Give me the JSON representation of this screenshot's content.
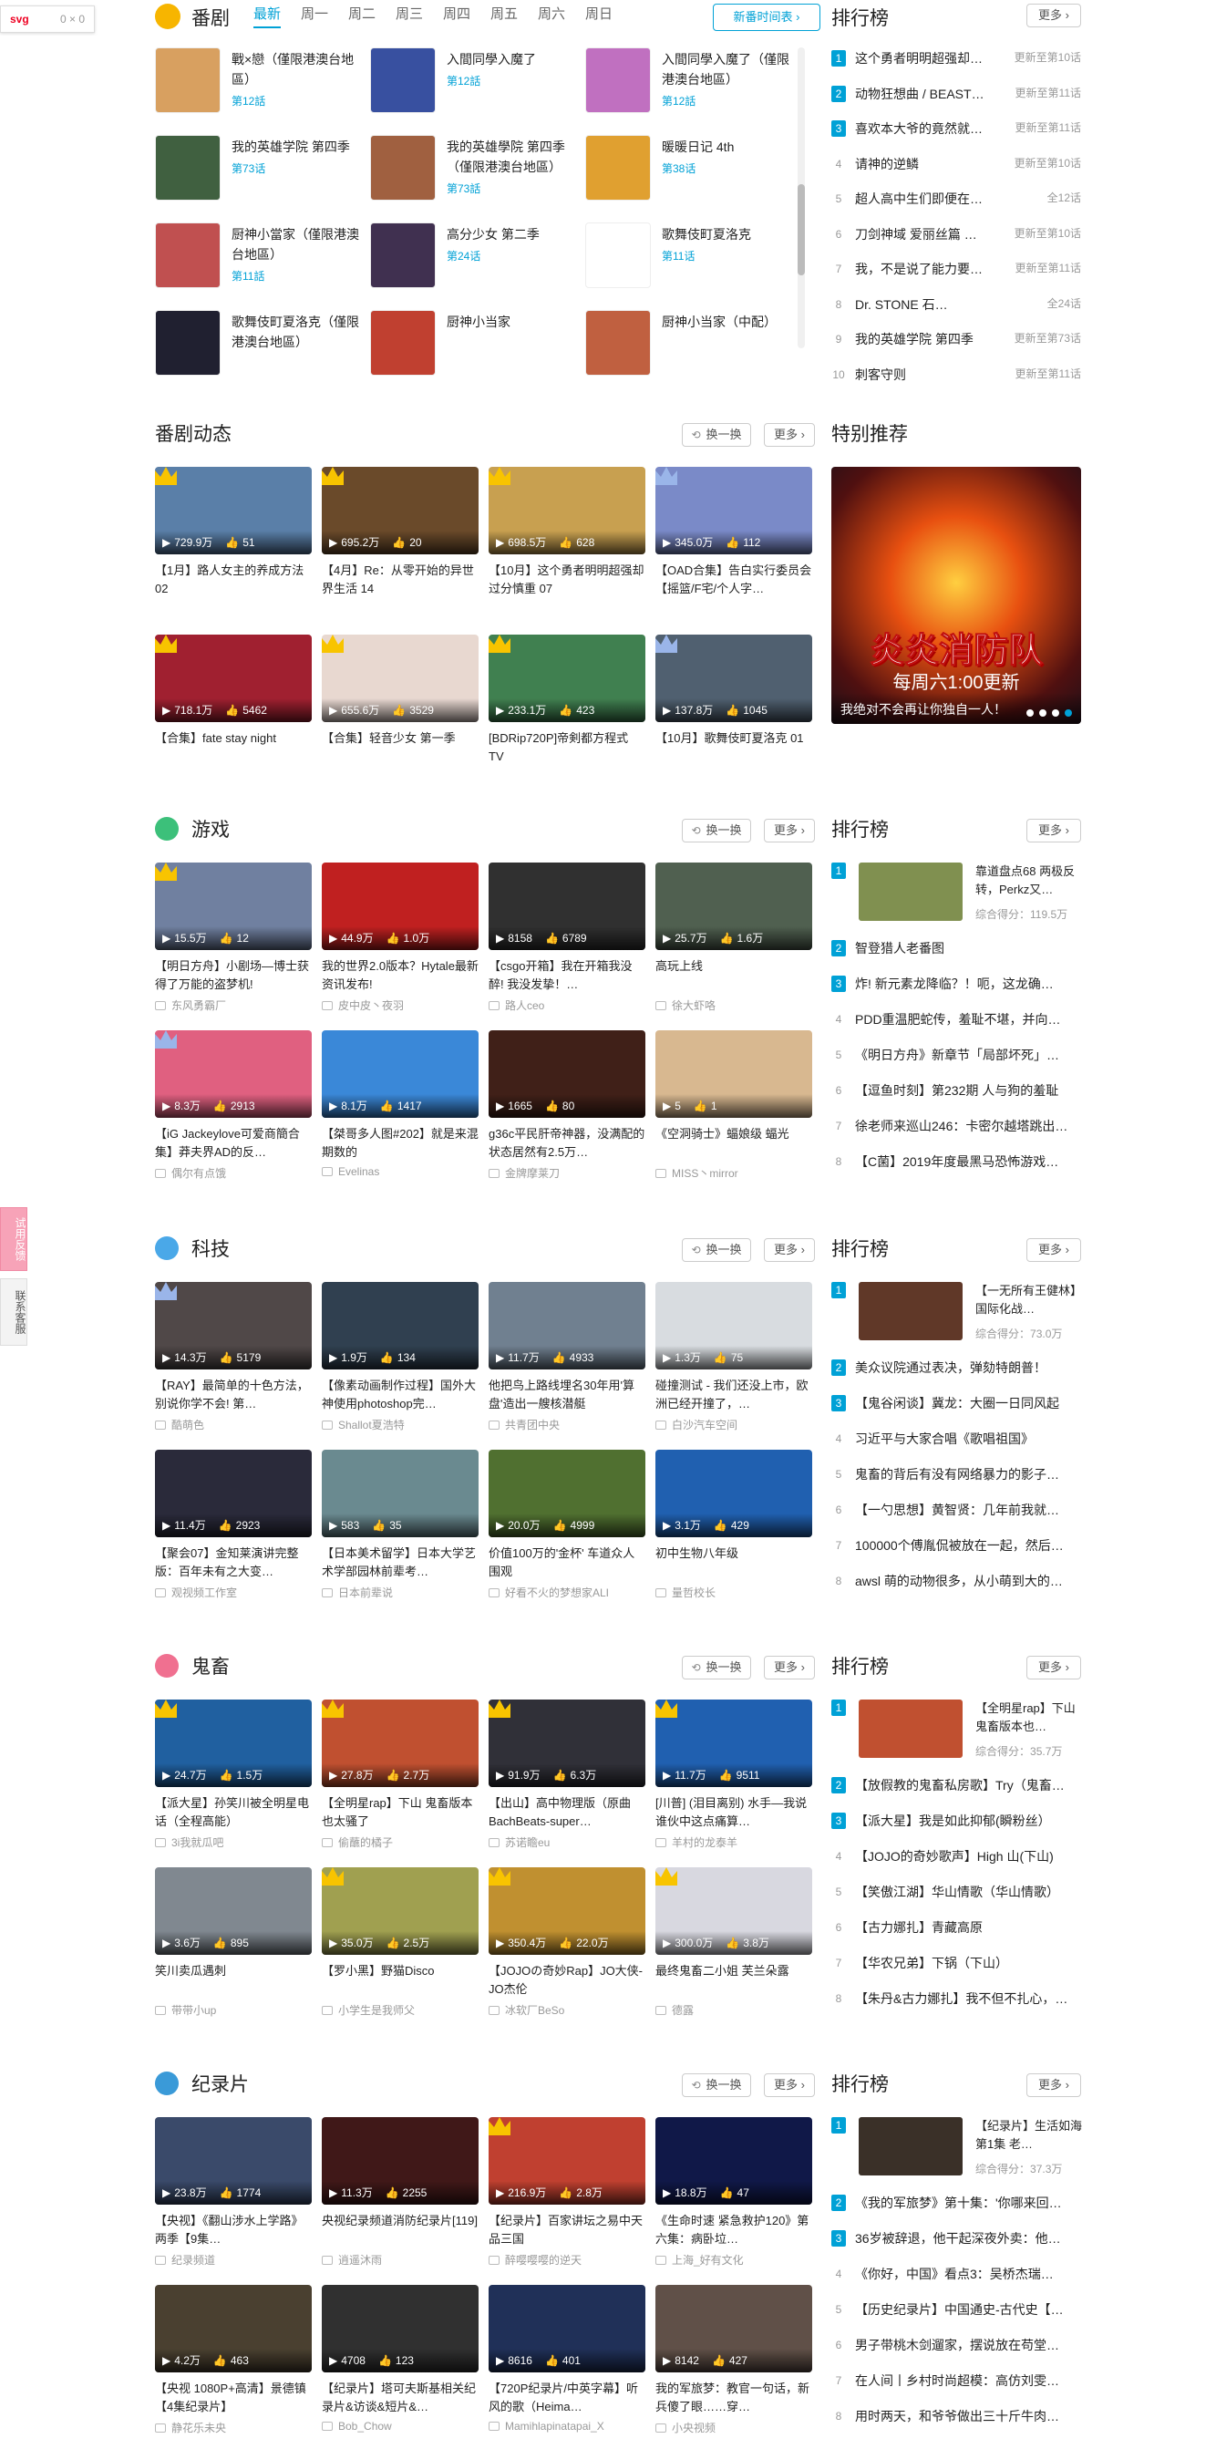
{
  "devbadge": {
    "label": "svg",
    "size": "0 × 0"
  },
  "feedback": {
    "label1": "试用反馈",
    "label2": "联系客服"
  },
  "common": {
    "more": "更多",
    "refresh": "换一换",
    "rank": "排行榜",
    "score_prefix": "综合得分："
  },
  "bangumi": {
    "title": "番剧",
    "tabs": [
      "最新",
      "周一",
      "周二",
      "周三",
      "周四",
      "周五",
      "周六",
      "周日"
    ],
    "new_timeline_btn": "新番时间表",
    "items": [
      {
        "title": "戰×戀（僅限港澳台地區）",
        "ep": "第12話",
        "color": "#d8a060"
      },
      {
        "title": "入間同學入魔了",
        "ep": "第12話",
        "color": "#3850a0"
      },
      {
        "title": "入間同學入魔了（僅限港澳台地區）",
        "ep": "第12話",
        "color": "#c070c0"
      },
      {
        "title": "我的英雄学院 第四季",
        "ep": "第73话",
        "color": "#406040"
      },
      {
        "title": "我的英雄學院 第四季（僅限港澳台地區）",
        "ep": "第73話",
        "color": "#a06040"
      },
      {
        "title": "暖暖日记 4th",
        "ep": "第38话",
        "color": "#e0a030"
      },
      {
        "title": "厨神小當家（僅限港澳台地區）",
        "ep": "第11話",
        "color": "#c05050"
      },
      {
        "title": "高分少女 第二季",
        "ep": "第24话",
        "color": "#403050"
      },
      {
        "title": "歌舞伎町夏洛克",
        "ep": "第11话",
        "color": "#ffffff"
      },
      {
        "title": "歌舞伎町夏洛克（僅限港澳台地區）",
        "ep": "",
        "color": "#202030"
      },
      {
        "title": "厨神小当家",
        "ep": "",
        "color": "#c04030"
      },
      {
        "title": "厨神小当家（中配）",
        "ep": "",
        "color": "#c06040"
      }
    ],
    "rank": [
      {
        "n": "1",
        "title": "这个勇者明明超强却…",
        "ep": "更新至第10话"
      },
      {
        "n": "2",
        "title": "动物狂想曲 / BEAST…",
        "ep": "更新至第11话"
      },
      {
        "n": "3",
        "title": "喜欢本大爷的竟然就…",
        "ep": "更新至第11话"
      },
      {
        "n": "4",
        "title": "请神的逆鳞",
        "ep": "更新至第10话"
      },
      {
        "n": "5",
        "title": "超人高中生们即便在…",
        "ep": "全12话"
      },
      {
        "n": "6",
        "title": "刀剑神域 爱丽丝篇 …",
        "ep": "更新至第10话"
      },
      {
        "n": "7",
        "title": "我，不是说了能力要…",
        "ep": "更新至第11话"
      },
      {
        "n": "8",
        "title": "Dr. STONE 石…",
        "ep": "全24话"
      },
      {
        "n": "9",
        "title": "我的英雄学院 第四季",
        "ep": "更新至第73话"
      },
      {
        "n": "10",
        "title": "刺客守则",
        "ep": "更新至第11话"
      }
    ]
  },
  "dongtai": {
    "title": "番剧动态",
    "cards": [
      {
        "title": "【1月】路人女主的养成方法 02",
        "play": "729.9万",
        "like": "51",
        "crown": "gold",
        "color": "#5a7fa8"
      },
      {
        "title": "【4月】Re：从零开始的异世界生活 14",
        "play": "695.2万",
        "like": "20",
        "crown": "gold",
        "color": "#6a4a2a"
      },
      {
        "title": "【10月】这个勇者明明超强却过分慎重 07",
        "play": "698.5万",
        "like": "628",
        "crown": "gold",
        "color": "#c8a050"
      },
      {
        "title": "【OAD合集】告白实行委员会【摇篮/F宅/个人字…",
        "play": "345.0万",
        "like": "112",
        "crown": "blue",
        "color": "#7a8ac8"
      },
      {
        "title": "【合集】fate stay night",
        "play": "718.1万",
        "like": "5462",
        "crown": "gold",
        "color": "#a02030"
      },
      {
        "title": "【合集】轻音少女 第一季",
        "play": "655.6万",
        "like": "3529",
        "crown": "gold",
        "color": "#e8d8d0"
      },
      {
        "title": "[BDRip720P]帝剣都方程式 TV",
        "play": "233.1万",
        "like": "423",
        "crown": "gold",
        "color": "#408050"
      },
      {
        "title": "【10月】歌舞伎町夏洛克 01",
        "play": "137.8万",
        "like": "1045",
        "crown": "blue",
        "color": "#506070"
      }
    ],
    "special": {
      "title": "特别推荐",
      "banner_title": "炎炎消防队",
      "banner_sub": "每周六1:00更新",
      "banner_caption": "我绝对不会再让你独自一人！"
    }
  },
  "youxi": {
    "title": "游戏",
    "cards": [
      {
        "title": "【明日方舟】小剧场—博士获得了万能的盗梦机!",
        "play": "15.5万",
        "like": "12",
        "up": "东风勇霸厂",
        "crown": "gold",
        "color": "#7080a0"
      },
      {
        "title": "我的世界2.0版本？Hytale最新资讯发布!",
        "play": "44.9万",
        "like": "1.0万",
        "up": "皮中皮丶夜羽",
        "crown": "",
        "color": "#c02020"
      },
      {
        "title": "【csgo开箱】我在开箱我没醉! 我没发挚！…",
        "play": "8158",
        "like": "6789",
        "up": "路人ceo",
        "crown": "",
        "color": "#303030"
      },
      {
        "title": "高玩上线",
        "play": "25.7万",
        "like": "1.6万",
        "up": "徐大虾咯",
        "crown": "",
        "color": "#506050"
      },
      {
        "title": "【iG Jackeylove可爱商簡合集】莽夫界AD的反…",
        "play": "8.3万",
        "like": "2913",
        "up": "偶尔有点饿",
        "crown": "blue",
        "color": "#e06080"
      },
      {
        "title": "【桀哥多人图#202】就是来混期数的",
        "play": "8.1万",
        "like": "1417",
        "up": "Evelinas",
        "crown": "",
        "color": "#3a88d8"
      },
      {
        "title": "g36c平民肝帝神器，没满配的状态居然有2.5万…",
        "play": "1665",
        "like": "80",
        "up": "金牌摩莱刀",
        "crown": "",
        "color": "#402018"
      },
      {
        "title": "《空洞骑士》蝠娘级 蝠光",
        "play": "5",
        "like": "1",
        "up": "MISS丶mirror",
        "crown": "",
        "color": "#d8b890"
      }
    ],
    "rank_feature": {
      "title": "靠道盘点68 两极反转，Perkz又…",
      "score": "119.5万",
      "color": "#809050"
    },
    "rank": [
      "智登猎人老番图",
      "炸! 新元素龙降临？！呃，这龙确…",
      "PDD重温肥蛇传，羞耻不堪，并向…",
      "《明日方舟》新章节「局部坏死」…",
      "【逗鱼时刻】第232期 人与狗的羞耻",
      "徐老师来巡山246：卡密尔越塔跳出…",
      "【C菌】2019年度最黑马恐怖游戏…"
    ]
  },
  "keji": {
    "title": "科技",
    "cards": [
      {
        "title": "【RAY】最简单的十色方法，别说你学不会! 第…",
        "play": "14.3万",
        "like": "5179",
        "up": "酷萌色",
        "crown": "blue",
        "color": "#504848"
      },
      {
        "title": "【像素动画制作过程】国外大神使用photoshop完…",
        "play": "1.9万",
        "like": "134",
        "up": "Shallot夏浩特",
        "crown": "",
        "color": "#304050"
      },
      {
        "title": "他把鸟上路线埋名30年用'算盘'造出一艘核潜艇",
        "play": "11.7万",
        "like": "4933",
        "up": "共青团中央",
        "crown": "",
        "color": "#708090"
      },
      {
        "title": "碰撞测试 - 我们还没上市，欧洲已经开撞了，…",
        "play": "1.3万",
        "like": "75",
        "up": "白沙汽车空间",
        "crown": "",
        "color": "#d8dce0"
      },
      {
        "title": "【聚会07】金知莱演讲完整版：百年未有之大变…",
        "play": "11.4万",
        "like": "2923",
        "up": "观视频工作室",
        "crown": "",
        "color": "#2a2a3a"
      },
      {
        "title": "【日本美术留学】日本大学艺术学部园林前辈考…",
        "play": "583",
        "like": "35",
        "up": "日本前辈说",
        "crown": "",
        "color": "#6a8a90"
      },
      {
        "title": "价值100万的'金杯' 车道众人围观",
        "play": "20.0万",
        "like": "4999",
        "up": "好看不火的梦想家ALI",
        "crown": "",
        "color": "#507030"
      },
      {
        "title": "初中生物八年级",
        "play": "3.1万",
        "like": "429",
        "up": "量哲校长",
        "crown": "",
        "color": "#2060b0"
      }
    ],
    "rank_feature": {
      "title": "【一无所有王健林】国际化战…",
      "score": "73.0万",
      "color": "#603828"
    },
    "rank": [
      "美众议院通过表决，弹劾特朗普！",
      "【鬼谷闲谈】冀龙：大圈一日同风起",
      "习近平与大家合唱《歌唱祖国》",
      "鬼畜的背后有没有网络暴力的影子…",
      "【一勺思想】黄智贤：几年前我就…",
      "100000个傅胤侃被放在一起，然后委…",
      "awsl 萌的动物很多，从小萌到大的…"
    ]
  },
  "guichu": {
    "title": "鬼畜",
    "cards": [
      {
        "title": "【派大星】孙笑川被全明星电话（全程高能）",
        "play": "24.7万",
        "like": "1.5万",
        "up": "3i我就瓜吧",
        "crown": "gold",
        "color": "#2060a0"
      },
      {
        "title": "【全明星rap】下山 鬼畜版本也太骚了",
        "play": "27.8万",
        "like": "2.7万",
        "up": "偷蘸的橘子",
        "crown": "gold",
        "color": "#c05030"
      },
      {
        "title": "【出山】高中物理版（原曲BachBeats-super…",
        "play": "91.9万",
        "like": "6.3万",
        "up": "苏诺瞻eu",
        "crown": "gold",
        "color": "#303038"
      },
      {
        "title": "[川普] (泪目离别) 水手—我说谁伙中这点痛算…",
        "play": "11.7万",
        "like": "9511",
        "up": "羊村的龙泰羊",
        "crown": "gold",
        "color": "#2060b0"
      },
      {
        "title": "笑川卖瓜遇刺",
        "play": "3.6万",
        "like": "895",
        "up": "带带小up",
        "crown": "",
        "color": "#808890"
      },
      {
        "title": "【罗小黑】野猫Disco",
        "play": "35.0万",
        "like": "2.5万",
        "up": "小学生是我师父",
        "crown": "gold",
        "color": "#a0a050"
      },
      {
        "title": "【JOJOの奇妙Rap】JO大侠-JO杰伦",
        "play": "350.4万",
        "like": "22.0万",
        "up": "冰软厂BeSo",
        "crown": "gold",
        "color": "#c09030"
      },
      {
        "title": "最终鬼畜二小姐 芙兰朵露",
        "play": "300.0万",
        "like": "3.8万",
        "up": "德露",
        "crown": "gold",
        "color": "#d8d8e0"
      }
    ],
    "rank_feature": {
      "title": "【全明星rap】下山 鬼畜版本也…",
      "score": "35.7万",
      "color": "#c05030"
    },
    "rank": [
      "【放假教的鬼畜私房歌】Try（鬼畜…",
      "【派大星】我是如此抑郁(瞬粉丝）",
      "【JOJO的奇妙歌声】High 山(下山)",
      "【笑傲江湖】华山情歌（华山情歌）",
      "【古力娜扎】青藏高原",
      "【华农兄弟】下锅（下山）",
      "【朱丹&古力娜扎】我不但不扎心，…"
    ]
  },
  "jilupian": {
    "title": "纪录片",
    "cards": [
      {
        "title": "【央视】《翻山涉水上学路》两季【9集…",
        "play": "23.8万",
        "like": "1774",
        "up": "纪录频道",
        "crown": "",
        "color": "#3a4a6a"
      },
      {
        "title": "央视纪录频道消防纪录片[119]",
        "play": "11.3万",
        "like": "2255",
        "up": "逍遥沐雨",
        "crown": "",
        "color": "#401818"
      },
      {
        "title": "【纪录片】百家讲坛之易中天品三国",
        "play": "216.9万",
        "like": "2.8万",
        "up": "醉嘤嘤嘤的逆天",
        "crown": "gold",
        "color": "#c04030"
      },
      {
        "title": "《生命时速 紧急救护120》第六集：病卧垃…",
        "play": "18.8万",
        "like": "47",
        "up": "上海_好有文化",
        "crown": "",
        "color": "#101848"
      },
      {
        "title": "【央视 1080P+高清】景德镇【4集纪录片】",
        "play": "4.2万",
        "like": "463",
        "up": "静花乐未央",
        "crown": "",
        "color": "#4a4030"
      },
      {
        "title": "【纪录片】塔可夫斯基相关纪录片&访谈&短片&…",
        "play": "4708",
        "like": "123",
        "up": "Bob_Chow",
        "crown": "",
        "color": "#303030"
      },
      {
        "title": "【720P纪录片/中英字幕】听风的歌（Heima…",
        "play": "8616",
        "like": "401",
        "up": "Mamihlapinatapai_X",
        "crown": "",
        "color": "#203058"
      },
      {
        "title": "我的军旅梦：教官一句话，新兵傻了眼……穿…",
        "play": "8142",
        "like": "427",
        "up": "小央视频",
        "crown": "",
        "color": "#605048"
      }
    ],
    "rank_feature": {
      "title": "【纪录片】生活如海 第1集 老…",
      "score": "37.3万",
      "color": "#3a3028"
    },
    "rank": [
      "《我的军旅梦》第十集：'你哪来回…",
      "36岁被辞退，他干起深夜外卖：他…",
      "《你好，中国》看点3：吴桥杰瑞…",
      "【历史纪录片】中国通史-古代史【…",
      "男子带桃木剑遛家，摆说放在苟堂…",
      "在人间丨乡村时尚超模：高仿刘雯…",
      "用时两天，和爷爷做出三十斤牛肉…"
    ]
  }
}
